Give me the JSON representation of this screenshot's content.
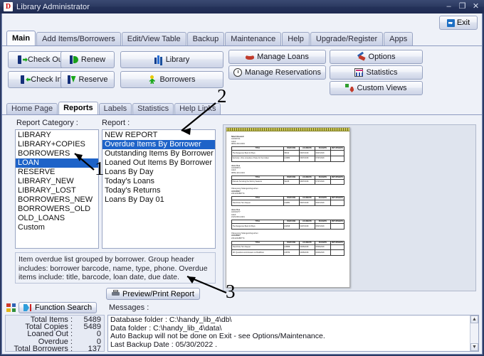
{
  "window": {
    "title": "Library Administrator",
    "icon": "D",
    "minimize": "–",
    "maximize": "❐",
    "close": "✕"
  },
  "toolbar": {
    "exit_label": "Exit",
    "exit_icon": "exit-arrow-icon"
  },
  "main_tabs": [
    {
      "label": "Main",
      "active": true
    },
    {
      "label": "Add Items/Borrowers",
      "active": false
    },
    {
      "label": "Edit/View Table",
      "active": false
    },
    {
      "label": "Backup",
      "active": false
    },
    {
      "label": "Maintenance",
      "active": false
    },
    {
      "label": "Help",
      "active": false
    },
    {
      "label": "Upgrade/Register",
      "active": false
    },
    {
      "label": "Apps",
      "active": false
    }
  ],
  "action_buttons": [
    {
      "label": "Check Out",
      "icon": "door-out-icon"
    },
    {
      "label": "Renew",
      "icon": "renew-icon"
    },
    {
      "label": "Library",
      "icon": "library-books-icon"
    },
    {
      "label": "Manage Loans",
      "icon": "manage-loans-icon"
    },
    {
      "label": "Options",
      "icon": "options-tools-icon"
    },
    {
      "label": "Check In",
      "icon": "door-in-icon"
    },
    {
      "label": "Reserve",
      "icon": "reserve-icon"
    },
    {
      "label": "Borrowers",
      "icon": "borrowers-person-icon"
    },
    {
      "label": "Manage Reservations",
      "icon": "clock-icon"
    },
    {
      "label": "Statistics",
      "icon": "statistics-chart-icon"
    },
    {
      "label": "Custom Views",
      "icon": "custom-views-icon"
    }
  ],
  "sub_tabs": [
    {
      "label": "Home Page",
      "active": false
    },
    {
      "label": "Reports",
      "active": true
    },
    {
      "label": "Labels",
      "active": false
    },
    {
      "label": "Statistics",
      "active": false
    },
    {
      "label": "Help Links",
      "active": false
    }
  ],
  "reports": {
    "category_label": "Report Category :",
    "report_label": "Report :",
    "categories": [
      {
        "label": "LIBRARY",
        "selected": false
      },
      {
        "label": "LIBRARY+COPIES",
        "selected": false
      },
      {
        "label": "BORROWERS",
        "selected": false
      },
      {
        "label": "LOAN",
        "selected": true
      },
      {
        "label": "RESERVE",
        "selected": false
      },
      {
        "label": "LIBRARY_NEW",
        "selected": false
      },
      {
        "label": "LIBRARY_LOST",
        "selected": false
      },
      {
        "label": "BORROWERS_NEW",
        "selected": false
      },
      {
        "label": "BORROWERS_OLD",
        "selected": false
      },
      {
        "label": "OLD_LOANS",
        "selected": false
      },
      {
        "label": "Custom",
        "selected": false
      }
    ],
    "reports": [
      {
        "label": "NEW REPORT",
        "selected": false
      },
      {
        "label": "Overdue Items By Borrower",
        "selected": true
      },
      {
        "label": "Outstanding Items By Borrower",
        "selected": false
      },
      {
        "label": "Loaned Out Items By Borrower",
        "selected": false
      },
      {
        "label": "Loans By Day",
        "selected": false
      },
      {
        "label": "Today's Loans",
        "selected": false
      },
      {
        "label": "Today's Returns",
        "selected": false
      },
      {
        "label": "Loans By Day 01",
        "selected": false
      }
    ],
    "description": "Item overdue list grouped by borrower. Group header includes: borrower barcode, name, type, phone. Overdue items include: title, barcode, loan date, due date.",
    "preview_print_label": "Preview/Print Report",
    "preview_print_icon": "printer-icon"
  },
  "preview": {
    "columns": [
      "TITLE",
      "BARCODE",
      "LOANDATE",
      "DUEDATE",
      "RETURNDATE"
    ],
    "groups": [
      {
        "name": "Nkali Nnamdi",
        "barcode": "A1026741",
        "type": "Adult",
        "phone": "0803-333-3333",
        "rows": [
          [
            "The Dangerous Book for Boys",
            "S5012",
            "06/07/2018",
            "06/07/2018",
            ""
          ],
          [
            "Seriously - Nice remedies of hope for the broken",
            "L00880",
            "06/07/2018",
            "07/07/2018",
            ""
          ]
        ]
      },
      {
        "name": "Jane Doe",
        "barcode": "A1026874",
        "type": "Adult",
        "phone": "0809-444-4444",
        "rows": [
          [
            "Pamela: Surviving the Stormy Seasons",
            "S2228",
            "06/07/2018",
            "07/07/2018",
            ""
          ]
        ]
      },
      {
        "name": "Olaseyang Ndangwolingushun",
        "barcode": "A1018847",
        "type": "241124A88774",
        "phone": "",
        "rows": [
          [
            "Tiwa Finite He's Deeper",
            "L02881",
            "06/07/2018",
            "06/07/2018",
            ""
          ]
        ]
      },
      {
        "name": "Jane Doe",
        "barcode": "A1016277",
        "type": "Adult",
        "phone": "2123-823-4441",
        "rows": [
          [
            "The Dangerous Book for Boys",
            "L02818",
            "01/07/2018",
            "05/07/2018",
            ""
          ]
        ]
      },
      {
        "name": "Olaseyang Ndangwolingushun",
        "barcode": "A1018847",
        "type": "241124A88774",
        "phone": "",
        "rows": [
          [
            "Tiwa Finite He's Deeper",
            "L08858",
            "04/06/2018",
            "05/06/2018",
            ""
          ],
          [
            "101 Questions and Answers on Buddhism",
            "L08750",
            "04/06/2018",
            "06/06/2018",
            ""
          ]
        ]
      }
    ]
  },
  "bottom": {
    "function_search_label": "Function Search",
    "function_search_icon": "function-search-icon",
    "grid_icon": "color-grid-icon",
    "messages_label": "Messages :",
    "stats": [
      {
        "key": "Total Items :",
        "value": "5489"
      },
      {
        "key": "Total Copies :",
        "value": "5489"
      },
      {
        "key": "Loaned Out :",
        "value": "0"
      },
      {
        "key": "Overdue :",
        "value": "0"
      },
      {
        "key": "Total Borrowers :",
        "value": "137"
      }
    ],
    "messages": "Database folder : C:\\handy_lib_4\\db\\\nData folder : C:\\handy_lib_4\\data\\\nAuto Backup will not be done on Exit - see Options/Maintenance.\nLast Backup Date : 05/30/2022 ."
  },
  "annotations": [
    {
      "label": "1"
    },
    {
      "label": "2"
    },
    {
      "label": "3"
    }
  ],
  "colors": {
    "titlebar": "#2c3a61",
    "selection": "#1e63c8",
    "panel": "#eef1f8"
  }
}
